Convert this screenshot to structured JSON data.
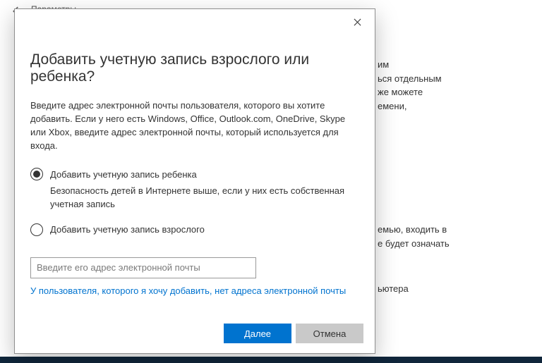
{
  "background": {
    "app_title": "Параметры",
    "text1": "им\nься отдельным\nже можете\nемени,",
    "text2": "емью, входить в\nе будет означать",
    "text3": "ьютера"
  },
  "dialog": {
    "title": "Добавить учетную запись взрослого или ребенка?",
    "description": "Введите адрес электронной почты пользователя, которого вы хотите добавить. Если у него есть Windows, Office, Outlook.com, OneDrive, Skype или Xbox, введите адрес электронной почты, который используется для входа.",
    "option_child": {
      "label": "Добавить учетную запись ребенка",
      "description": "Безопасность детей в Интернете выше, если у них есть собственная учетная запись",
      "selected": true
    },
    "option_adult": {
      "label": "Добавить учетную запись взрослого",
      "selected": false
    },
    "email_placeholder": "Введите его адрес электронной почты",
    "no_email_link": "У пользователя, которого я хочу добавить, нет адреса электронной почты",
    "buttons": {
      "next": "Далее",
      "cancel": "Отмена"
    }
  }
}
